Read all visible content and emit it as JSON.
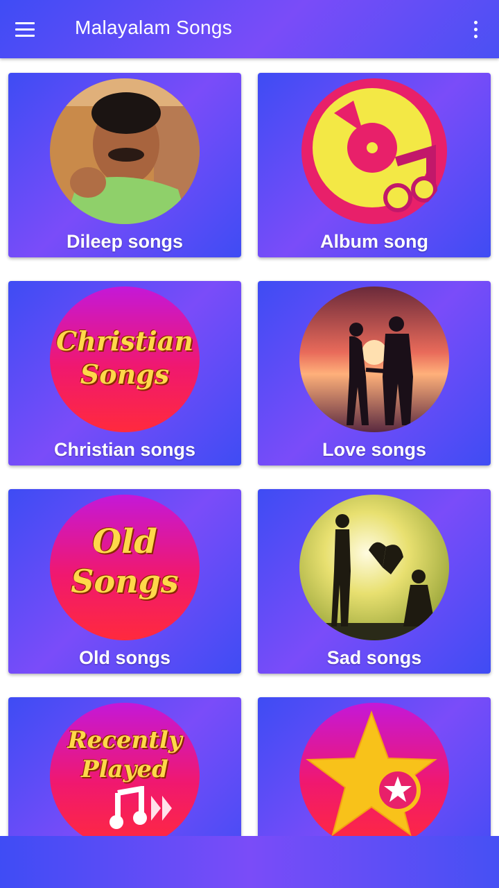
{
  "app": {
    "title": "Malayalam Songs",
    "menu_icon": "hamburger-menu-icon",
    "overflow_icon": "more-vert-icon"
  },
  "colors": {
    "primary": "#5a4cf6",
    "accent_pink": "#f0186f",
    "accent_yellow": "#ffd84a"
  },
  "categories": [
    {
      "label": "Dileep songs",
      "icon": "actor-photo"
    },
    {
      "label": "Album song",
      "icon": "music-disc-icon"
    },
    {
      "label": "Christian songs",
      "icon": "christian-songs-badge",
      "art_lines": [
        "Christian",
        "Songs"
      ]
    },
    {
      "label": "Love songs",
      "icon": "couple-silhouette"
    },
    {
      "label": "Old songs",
      "icon": "old-songs-badge",
      "art_lines": [
        "Old",
        "Songs"
      ]
    },
    {
      "label": "Sad songs",
      "icon": "broken-heart-silhouette"
    },
    {
      "label": "",
      "icon": "recently-played-badge",
      "art_lines": [
        "Recently",
        "Played"
      ]
    },
    {
      "label": "",
      "icon": "star-favorites-icon"
    }
  ]
}
